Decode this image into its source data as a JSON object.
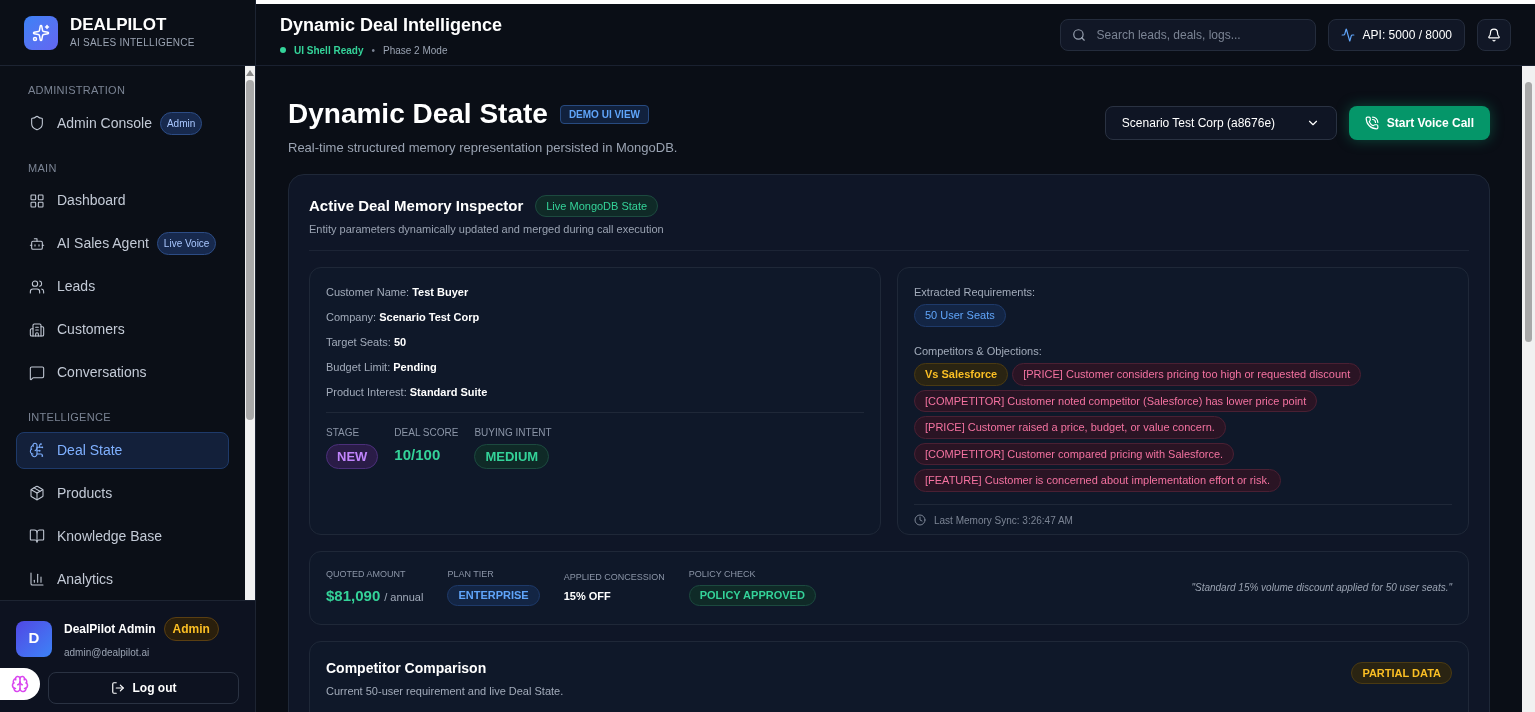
{
  "brand": {
    "name": "DEALPILOT",
    "tagline": "AI SALES INTELLIGENCE"
  },
  "sidebar": {
    "sections": [
      {
        "title": "ADMINISTRATION",
        "items": [
          {
            "label": "Admin Console",
            "selected": false,
            "badge": "Admin"
          }
        ]
      },
      {
        "title": "MAIN",
        "items": [
          {
            "label": "Dashboard",
            "selected": false
          },
          {
            "label": "AI Sales Agent",
            "selected": false,
            "badge": "Live Voice"
          },
          {
            "label": "Leads",
            "selected": false
          },
          {
            "label": "Customers",
            "selected": false
          },
          {
            "label": "Conversations",
            "selected": false
          }
        ]
      },
      {
        "title": "INTELLIGENCE",
        "items": [
          {
            "label": "Deal State",
            "selected": true
          },
          {
            "label": "Products",
            "selected": false
          },
          {
            "label": "Knowledge Base",
            "selected": false
          },
          {
            "label": "Analytics",
            "selected": false
          }
        ]
      }
    ],
    "user": {
      "initial": "D",
      "name": "DealPilot Admin",
      "role": "Admin",
      "email": "admin@dealpilot.ai"
    },
    "logout": "Log out"
  },
  "header": {
    "title": "Dynamic Deal Intelligence",
    "status": "UI Shell Ready",
    "mode": "Phase 2 Mode",
    "separator": "•",
    "search": {
      "placeholder": "Search leads, deals, logs..."
    },
    "api": "API: 5000 / 8000"
  },
  "page": {
    "title": "Dynamic Deal State",
    "tag": "DEMO UI VIEW",
    "subtitle": "Real-time structured memory representation persisted in MongoDB.",
    "select": "Scenario Test Corp (a8676e)",
    "call_button": "Start Voice Call"
  },
  "inspector": {
    "title": "Active Deal Memory Inspector",
    "badge": "Live MongoDB State",
    "subtitle": "Entity parameters dynamically updated and merged during call execution",
    "fields": [
      "Customer Name: **Test Buyer**",
      "Company: **Scenario Test Corp**",
      "Target Seats: **50**",
      "Budget Limit: **Pending**",
      "Product Interest: **Standard Suite**"
    ],
    "stats": [
      {
        "label": "STAGE",
        "value": "NEW",
        "kind": "purple-pill"
      },
      {
        "label": "DEAL SCORE",
        "value": "10/100",
        "kind": "number"
      },
      {
        "label": "BUYING INTENT",
        "value": "MEDIUM",
        "kind": "green-pill"
      }
    ],
    "requirements_label": "Extracted Requirements:",
    "requirements": [
      "50 User Seats"
    ],
    "objections_label": "Competitors & Objections:",
    "objections": [
      {
        "text": "Vs Salesforce",
        "kind": "competitor"
      },
      {
        "text": "[PRICE] Customer considers pricing too high or requested discount",
        "kind": "objection"
      },
      {
        "text": "[COMPETITOR] Customer noted competitor (Salesforce) has lower price point",
        "kind": "objection"
      },
      {
        "text": "[PRICE] Customer raised a price, budget, or value concern.",
        "kind": "objection"
      },
      {
        "text": "[COMPETITOR] Customer compared pricing with Salesforce.",
        "kind": "objection"
      },
      {
        "text": "[FEATURE] Customer is concerned about implementation effort or risk.",
        "kind": "objection"
      }
    ],
    "sync": "Last Memory Sync: 3:26:47 AM"
  },
  "quote": {
    "amount_label": "QUOTED AMOUNT",
    "amount": "$81,090",
    "period": "/ annual",
    "tier_label": "PLAN TIER",
    "tier": "ENTERPRISE",
    "concession_label": "APPLIED CONCESSION",
    "concession": "15% OFF",
    "policy_label": "POLICY CHECK",
    "policy": "POLICY APPROVED",
    "note": "\"Standard 15% volume discount applied for 50 user seats.\""
  },
  "comparison": {
    "title": "Competitor Comparison",
    "subtitle": "Current 50-user requirement and live Deal State.",
    "badge": "PARTIAL DATA"
  }
}
